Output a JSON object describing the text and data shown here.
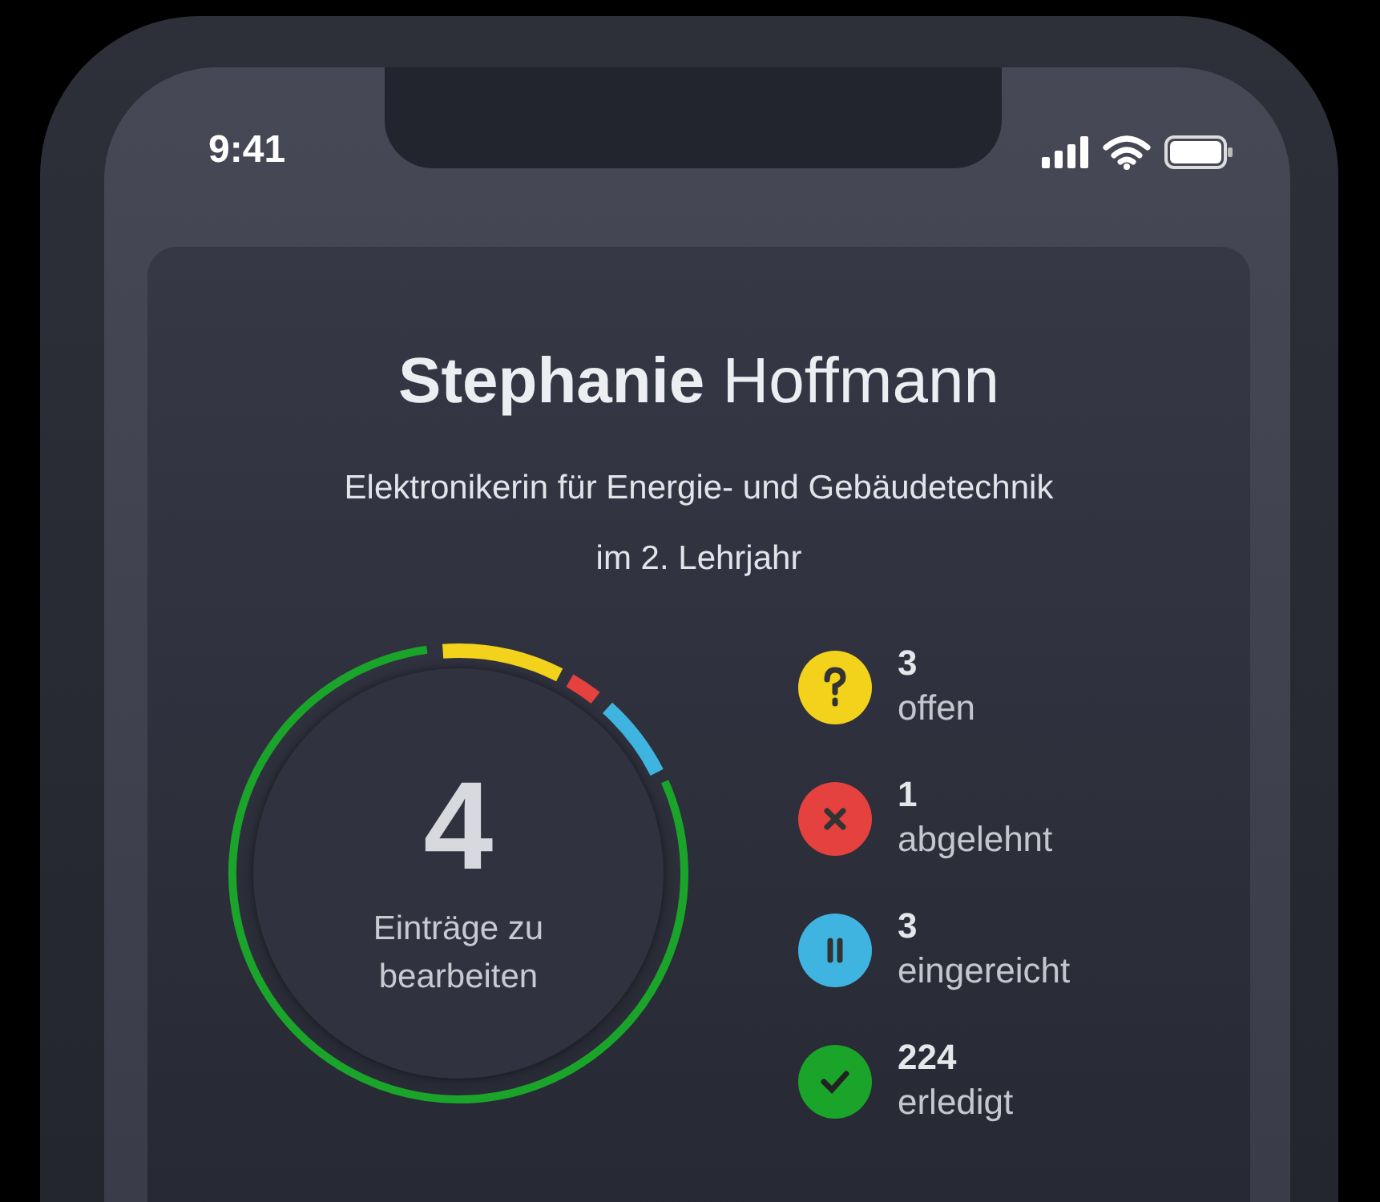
{
  "status_bar": {
    "time": "9:41"
  },
  "profile": {
    "name": "**Stephanie** Hoffmann",
    "subtitle_lines": [
      "Elektronikerin für Energie- und Gebäudetechnik",
      "im 2. Lehrjahr"
    ]
  },
  "summary": {
    "count": "4",
    "label_lines": [
      "Einträge zu",
      "bearbeiten"
    ]
  },
  "statuses": [
    {
      "kind": "open",
      "color": "#f2d21b",
      "count": "3",
      "label": "offen"
    },
    {
      "kind": "rejected",
      "color": "#e5413f",
      "count": "1",
      "label": "abgelehnt"
    },
    {
      "kind": "submitted",
      "color": "#3fb4e0",
      "count": "3",
      "label": "eingereicht"
    },
    {
      "kind": "done",
      "color": "#1aa52a",
      "count": "224",
      "label": "erledigt"
    }
  ]
}
